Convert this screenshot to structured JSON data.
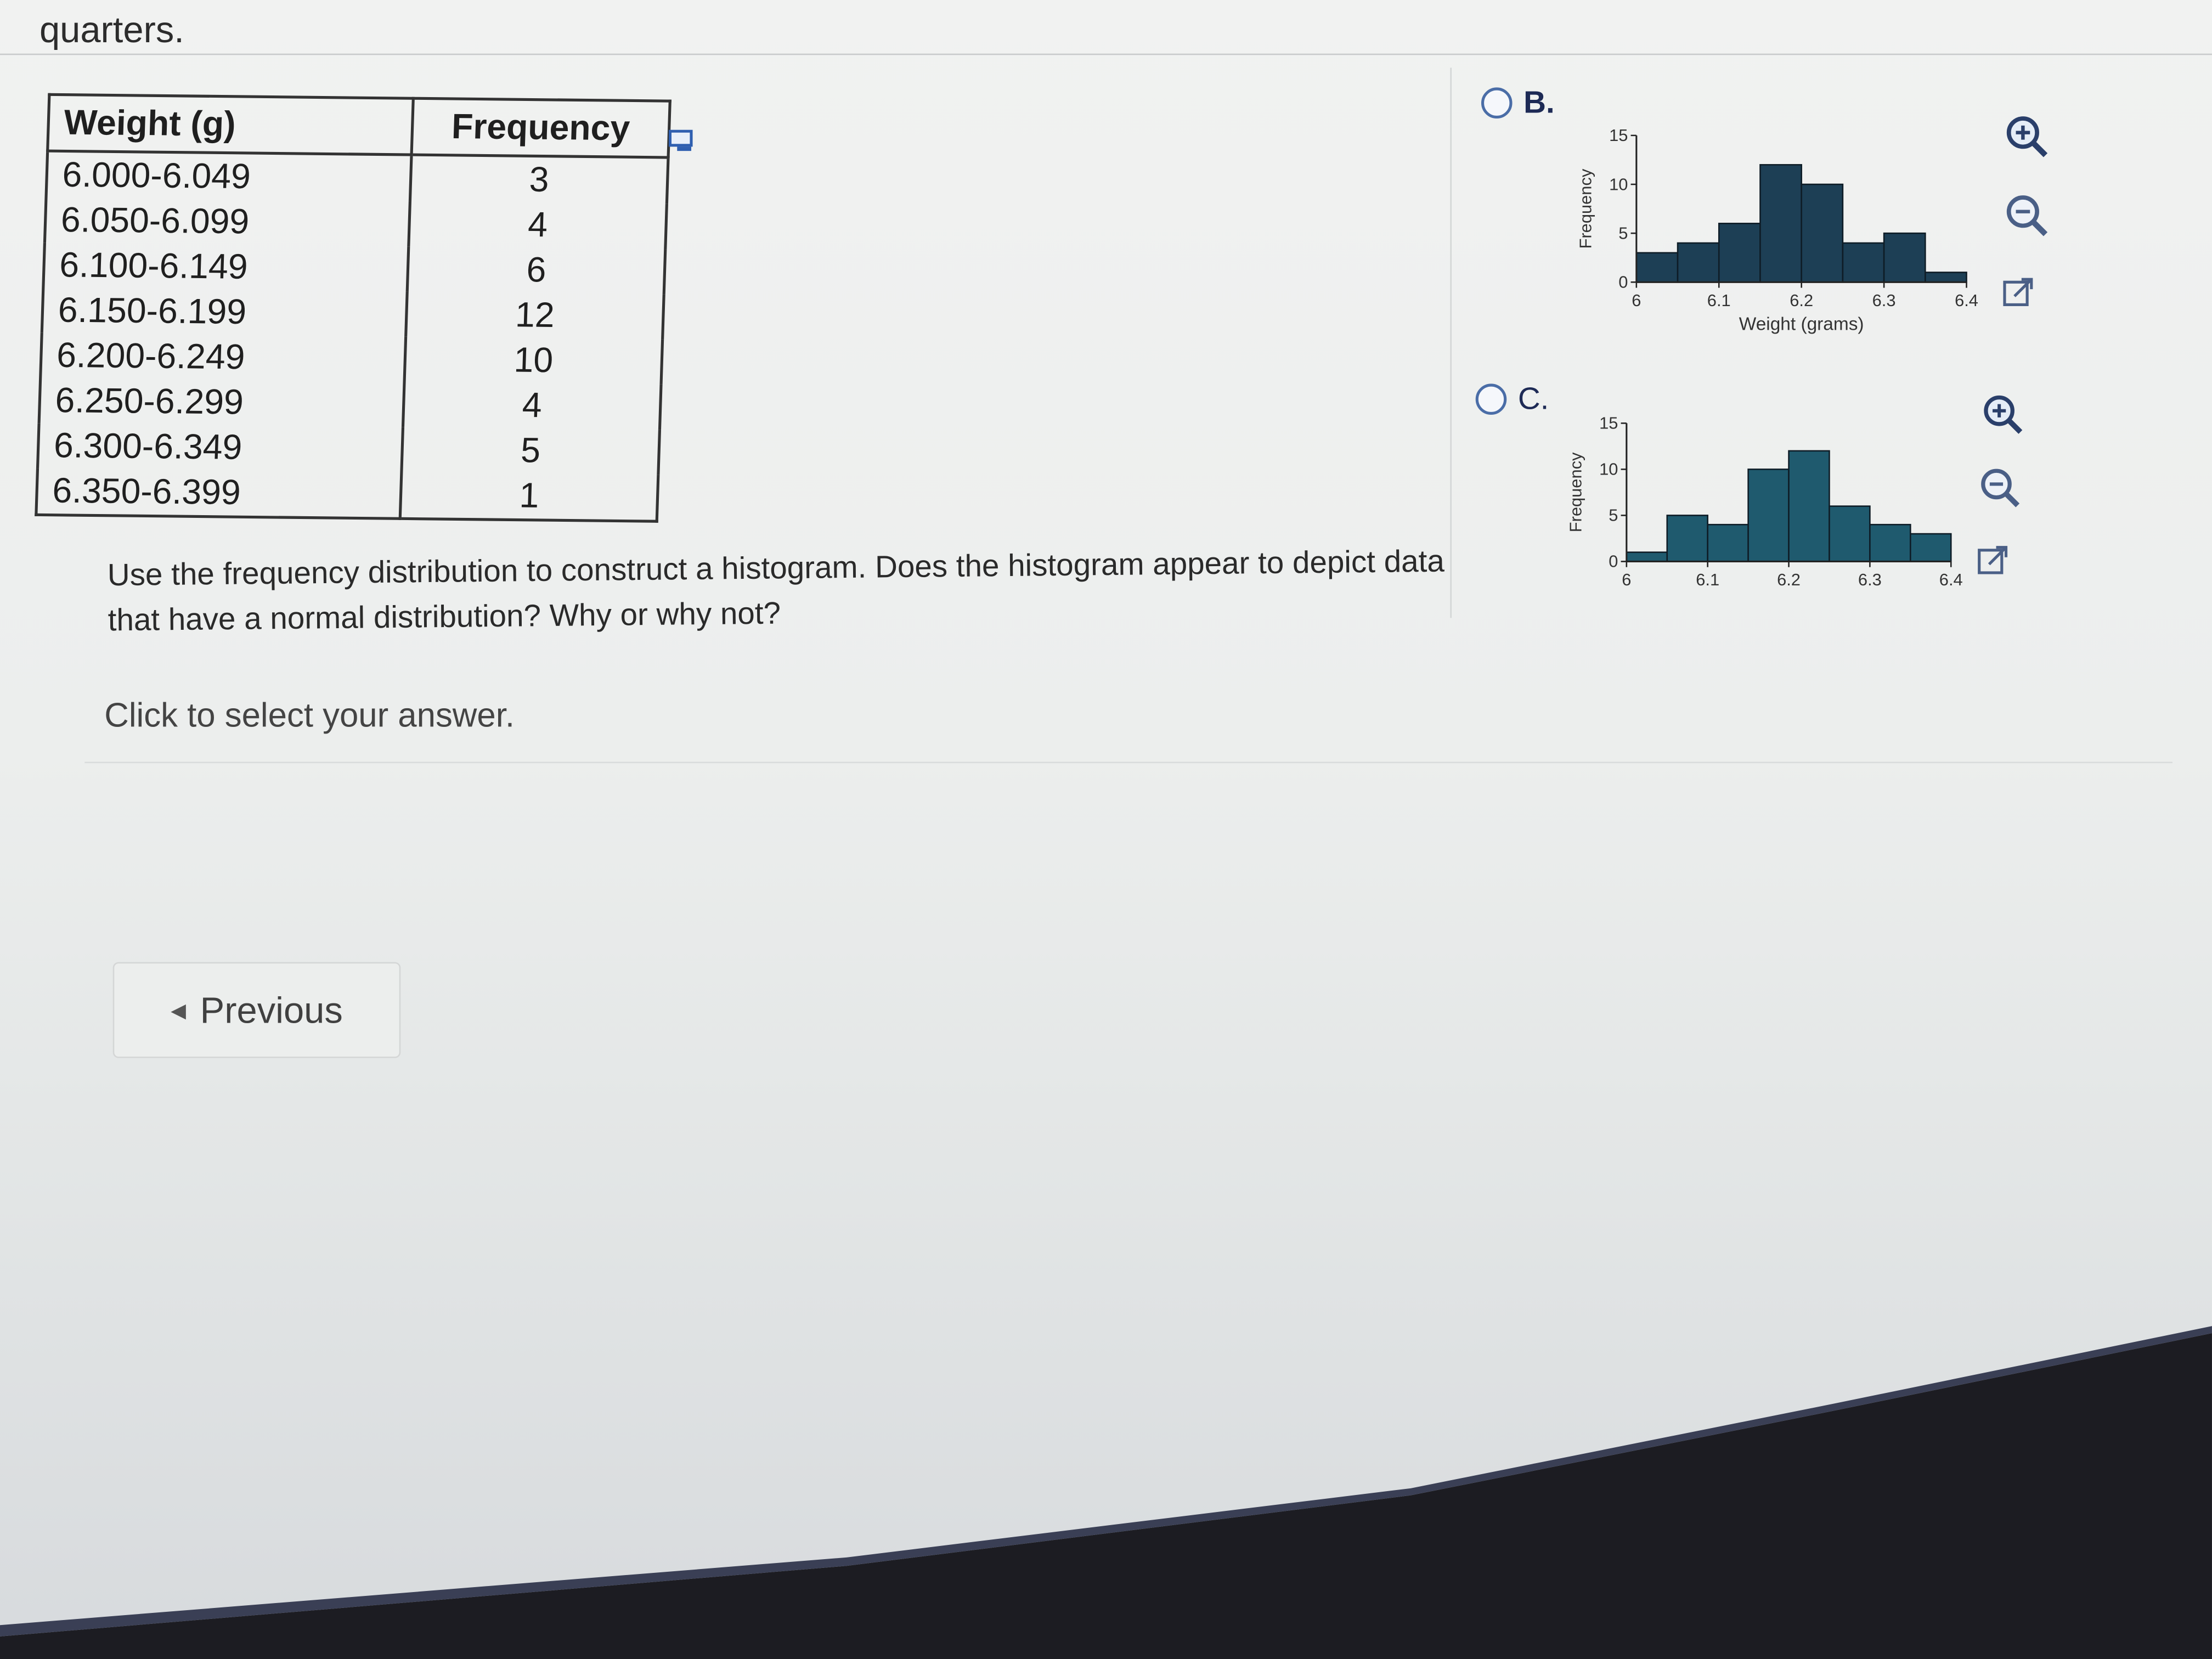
{
  "header": {
    "fragment_text": "quarters."
  },
  "table": {
    "headers": [
      "Weight (g)",
      "Frequency"
    ],
    "rows": [
      [
        "6.000-6.049",
        "3"
      ],
      [
        "6.050-6.099",
        "4"
      ],
      [
        "6.100-6.149",
        "6"
      ],
      [
        "6.150-6.199",
        "12"
      ],
      [
        "6.200-6.249",
        "10"
      ],
      [
        "6.250-6.299",
        "4"
      ],
      [
        "6.300-6.349",
        "5"
      ],
      [
        "6.350-6.399",
        "1"
      ]
    ]
  },
  "question": {
    "text": "Use the frequency distribution to construct a histogram. Does the histogram appear to depict data that have a normal distribution? Why or why not?",
    "hint": "Click to select your answer."
  },
  "navigation": {
    "previous_label": "Previous"
  },
  "options": [
    {
      "letter": "B.",
      "selected": false
    },
    {
      "letter": "C.",
      "selected": false
    }
  ],
  "chart_data": [
    {
      "type": "bar",
      "option": "B.",
      "ylabel": "Frequency",
      "xlabel": "Weight (grams)",
      "ylim": [
        0,
        15
      ],
      "xlim": [
        6.0,
        6.4
      ],
      "yticks": [
        "0",
        "5",
        "10",
        "15"
      ],
      "xticks": [
        "6",
        "6.1",
        "6.2",
        "6.3",
        "6.4"
      ],
      "bin_starts": [
        6.0,
        6.05,
        6.1,
        6.15,
        6.2,
        6.25,
        6.3,
        6.35
      ],
      "bin_width": 0.05,
      "values": [
        3,
        4,
        6,
        12,
        10,
        4,
        5,
        1
      ],
      "color": "#1d3f55"
    },
    {
      "type": "bar",
      "option": "C.",
      "ylabel": "Frequency",
      "xlabel": "",
      "ylim": [
        0,
        15
      ],
      "xlim": [
        6.0,
        6.4
      ],
      "yticks": [
        "0",
        "5",
        "10",
        "15"
      ],
      "xticks": [
        "6",
        "6.1",
        "6.2",
        "6.3",
        "6.4"
      ],
      "bin_starts": [
        6.0,
        6.05,
        6.1,
        6.15,
        6.2,
        6.25,
        6.3,
        6.35
      ],
      "bin_width": 0.05,
      "values": [
        1,
        5,
        4,
        10,
        12,
        6,
        4,
        3
      ],
      "color": "#1f5a6e"
    }
  ],
  "icons": [
    "zoom-in-icon",
    "zoom-out-icon",
    "popout-icon",
    "copy-table-icon"
  ]
}
